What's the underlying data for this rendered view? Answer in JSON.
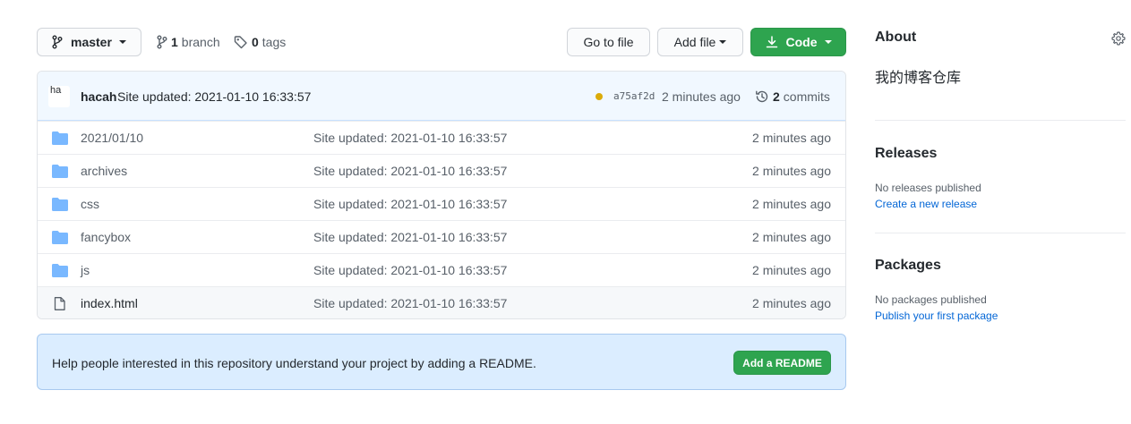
{
  "toolbar": {
    "branch_name": "master",
    "branches_count": "1",
    "branches_label": "branch",
    "tags_count": "0",
    "tags_label": "tags",
    "goto_file_label": "Go to file",
    "add_file_label": "Add file",
    "code_label": "Code"
  },
  "commit": {
    "avatar_alt": "ha",
    "author": "hacah",
    "message": "Site updated: 2021-01-10 16:33:57",
    "status_color": "#dbab09",
    "sha": "a75af2d",
    "time": "2 minutes ago",
    "commits_count": "2",
    "commits_label": "commits"
  },
  "files": [
    {
      "name": "2021/01/10",
      "type": "folder",
      "message": "Site updated: 2021-01-10 16:33:57",
      "age": "2 minutes ago"
    },
    {
      "name": "archives",
      "type": "folder",
      "message": "Site updated: 2021-01-10 16:33:57",
      "age": "2 minutes ago"
    },
    {
      "name": "css",
      "type": "folder",
      "message": "Site updated: 2021-01-10 16:33:57",
      "age": "2 minutes ago"
    },
    {
      "name": "fancybox",
      "type": "folder",
      "message": "Site updated: 2021-01-10 16:33:57",
      "age": "2 minutes ago"
    },
    {
      "name": "js",
      "type": "folder",
      "message": "Site updated: 2021-01-10 16:33:57",
      "age": "2 minutes ago"
    },
    {
      "name": "index.html",
      "type": "file",
      "message": "Site updated: 2021-01-10 16:33:57",
      "age": "2 minutes ago"
    }
  ],
  "readme": {
    "text": "Help people interested in this repository understand your project by adding a README.",
    "button_label": "Add a README"
  },
  "sidebar": {
    "about_title": "About",
    "about_description": "我的博客仓库",
    "releases_title": "Releases",
    "releases_note": "No releases published",
    "releases_link": "Create a new release",
    "packages_title": "Packages",
    "packages_note": "No packages published",
    "packages_link": "Publish your first package"
  },
  "colors": {
    "accent_green": "#2ea44f",
    "link_blue": "#0366d6",
    "folder_blue": "#79b8ff",
    "commit_header_bg": "#f1f8ff",
    "readme_bg": "#dbedff"
  },
  "icons": {
    "branch": "git-branch-icon",
    "tag": "tag-icon",
    "download": "download-icon",
    "history": "history-icon",
    "folder": "folder-icon",
    "file": "file-icon",
    "gear": "gear-icon"
  }
}
